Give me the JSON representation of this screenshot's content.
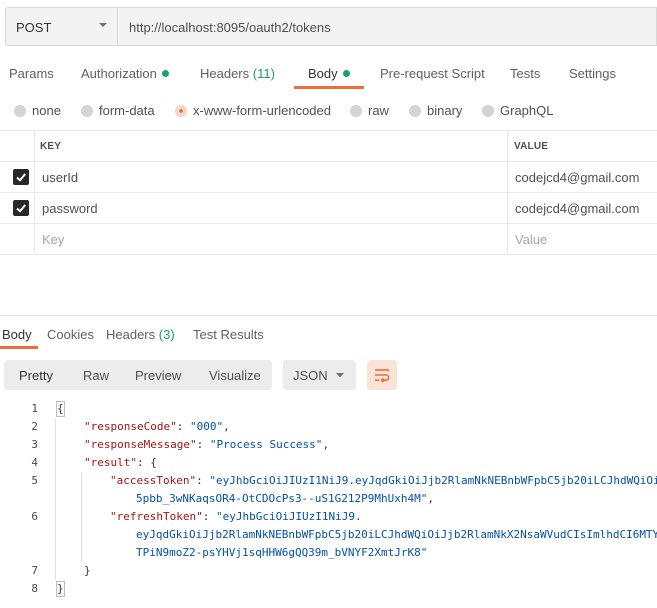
{
  "request": {
    "method": "POST",
    "url": "http://localhost:8095/oauth2/tokens"
  },
  "request_tabs": [
    {
      "label": "Params"
    },
    {
      "label": "Authorization",
      "indicator": "green-dot"
    },
    {
      "label": "Headers",
      "count": "(11)"
    },
    {
      "label": "Body",
      "indicator": "green-dot",
      "active": true
    },
    {
      "label": "Pre-request Script"
    },
    {
      "label": "Tests"
    },
    {
      "label": "Settings"
    }
  ],
  "body_types": [
    {
      "label": "none",
      "selected": false
    },
    {
      "label": "form-data",
      "selected": false
    },
    {
      "label": "x-www-form-urlencoded",
      "selected": true
    },
    {
      "label": "raw",
      "selected": false
    },
    {
      "label": "binary",
      "selected": false
    },
    {
      "label": "GraphQL",
      "selected": false
    }
  ],
  "params_table": {
    "headers": {
      "key": "KEY",
      "value": "VALUE"
    },
    "rows": [
      {
        "checked": true,
        "key": "userId",
        "value": "codejcd4@gmail.com"
      },
      {
        "checked": true,
        "key": "password",
        "value": "codejcd4@gmail.com"
      }
    ],
    "placeholder": {
      "key": "Key",
      "value": "Value"
    }
  },
  "response_tabs": [
    {
      "label": "Body",
      "active": true
    },
    {
      "label": "Cookies"
    },
    {
      "label": "Headers",
      "count": "(3)"
    },
    {
      "label": "Test Results"
    }
  ],
  "view_modes": [
    "Pretty",
    "Raw",
    "Preview",
    "Visualize"
  ],
  "format": "JSON",
  "response_body": {
    "line_numbers": [
      "1",
      "2",
      "3",
      "4",
      "5",
      "",
      "6",
      "",
      "",
      "7",
      "8"
    ],
    "open_brace": "{",
    "close_brace": "}",
    "responseCode_key": "\"responseCode\"",
    "responseCode_val": "\"000\"",
    "responseMessage_key": "\"responseMessage\"",
    "responseMessage_val": "\"Process Success\"",
    "result_key": "\"result\"",
    "accessToken_key": "\"accessToken\"",
    "accessToken_line1": "\"eyJhbGciOiJIUzI1NiJ9.eyJqdGkiOiJjb2RlamNkNEBnbWFpbC5jb20iLCJhdWQiOi",
    "accessToken_line2": "5pbb_3wNKaqsOR4-OtCDOcPs3--uS1G212P9MhUxh4M\"",
    "refreshToken_key": "\"refreshToken\"",
    "refreshToken_line1": "\"eyJhbGciOiJIUzI1NiJ9.",
    "refreshToken_line2": "eyJqdGkiOiJjb2RlamNkNEBnbWFpbC5jb20iLCJhdWQiOiJjb2RlamNkX2NsaWVudCIsImlhdCI6MTY",
    "refreshToken_line3": "TPiN9moZ2-psYHVj1sqHHW6gQQ39m_bVNYF2XmtJrK8\"",
    "result_close": "}"
  },
  "colors": {
    "accent": "#f26b3a",
    "status_green": "#19a463",
    "json_key": "#a31515",
    "json_string": "#0451a5"
  }
}
